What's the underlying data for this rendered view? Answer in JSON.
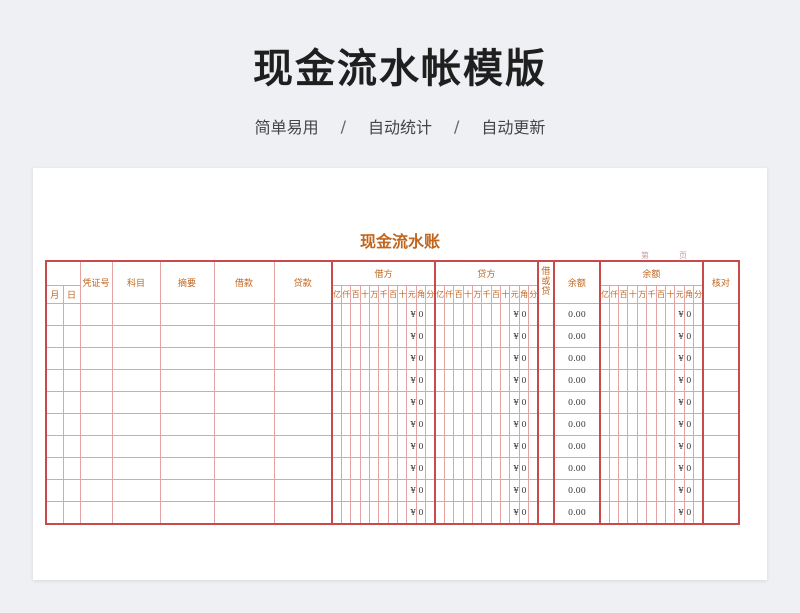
{
  "hero": {
    "title": "现金流水帐模版",
    "features": [
      "简单易用",
      "自动统计",
      "自动更新"
    ],
    "separator": "/"
  },
  "sheet": {
    "title": "现金流水账",
    "page_label_left": "第",
    "page_label_right": "页"
  },
  "ledger": {
    "headers": {
      "month": "月",
      "day": "日",
      "voucher": "凭证号",
      "subject": "科目",
      "summary": "摘要",
      "debit_col": "借款",
      "credit_col": "贷款",
      "debit_group": "借方",
      "credit_group": "贷方",
      "direction": "借\n或\n贷",
      "balance": "余额",
      "balance_group": "余额",
      "check": "核对"
    },
    "digits": [
      "亿",
      "仟",
      "百",
      "十",
      "万",
      "千",
      "百",
      "十",
      "元",
      "角",
      "分"
    ],
    "rows": [
      {
        "debit_yen": "¥",
        "debit_amt": "0",
        "credit_yen": "¥",
        "credit_amt": "0",
        "balance": "0.00",
        "bal_yen": "¥",
        "bal_amt": "0"
      },
      {
        "debit_yen": "¥",
        "debit_amt": "0",
        "credit_yen": "¥",
        "credit_amt": "0",
        "balance": "0.00",
        "bal_yen": "¥",
        "bal_amt": "0"
      },
      {
        "debit_yen": "¥",
        "debit_amt": "0",
        "credit_yen": "¥",
        "credit_amt": "0",
        "balance": "0.00",
        "bal_yen": "¥",
        "bal_amt": "0"
      },
      {
        "debit_yen": "¥",
        "debit_amt": "0",
        "credit_yen": "¥",
        "credit_amt": "0",
        "balance": "0.00",
        "bal_yen": "¥",
        "bal_amt": "0"
      },
      {
        "debit_yen": "¥",
        "debit_amt": "0",
        "credit_yen": "¥",
        "credit_amt": "0",
        "balance": "0.00",
        "bal_yen": "¥",
        "bal_amt": "0"
      },
      {
        "debit_yen": "¥",
        "debit_amt": "0",
        "credit_yen": "¥",
        "credit_amt": "0",
        "balance": "0.00",
        "bal_yen": "¥",
        "bal_amt": "0"
      },
      {
        "debit_yen": "¥",
        "debit_amt": "0",
        "credit_yen": "¥",
        "credit_amt": "0",
        "balance": "0.00",
        "bal_yen": "¥",
        "bal_amt": "0"
      },
      {
        "debit_yen": "¥",
        "debit_amt": "0",
        "credit_yen": "¥",
        "credit_amt": "0",
        "balance": "0.00",
        "bal_yen": "¥",
        "bal_amt": "0"
      },
      {
        "debit_yen": "¥",
        "debit_amt": "0",
        "credit_yen": "¥",
        "credit_amt": "0",
        "balance": "0.00",
        "bal_yen": "¥",
        "bal_amt": "0"
      },
      {
        "debit_yen": "¥",
        "debit_amt": "0",
        "credit_yen": "¥",
        "credit_amt": "0",
        "balance": "0.00",
        "bal_yen": "¥",
        "bal_amt": "0"
      }
    ]
  },
  "colors": {
    "header_text": "#c0661f",
    "grid_line": "#e3a3a3",
    "outer_border": "#c94a4a"
  }
}
